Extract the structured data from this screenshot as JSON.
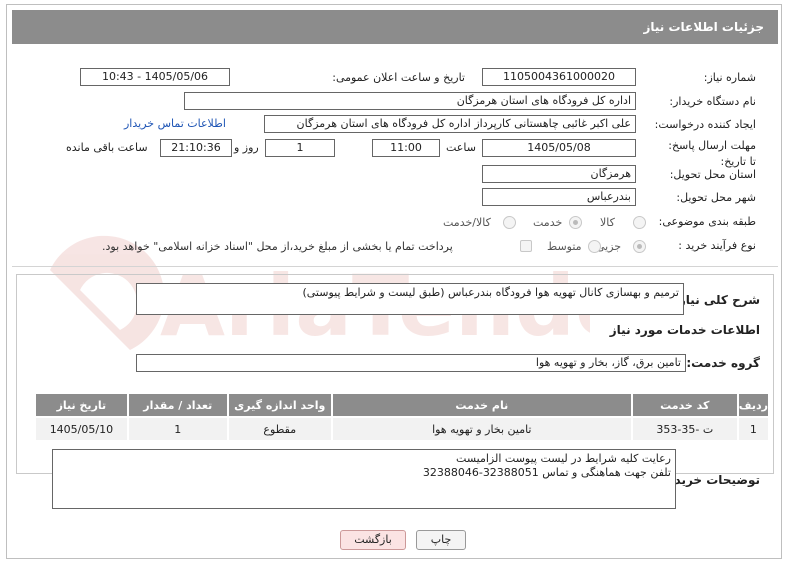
{
  "header": {
    "title": "جزئیات اطلاعات نیاز"
  },
  "fields": {
    "need_number": {
      "label": "شماره نیاز:",
      "value": "1105004361000020"
    },
    "announce_datetime": {
      "label": "تاریخ و ساعت اعلان عمومی:",
      "value": "1405/05/06 - 10:43"
    },
    "buyer_org": {
      "label": "نام دستگاه خریدار:",
      "value": "اداره کل فرودگاه های استان هرمزگان"
    },
    "requester": {
      "label": "ایجاد کننده درخواست:",
      "value": "علی اکبر غائبی چاهستانی کارپرداز اداره کل فرودگاه های استان هرمزگان",
      "contact_link": "اطلاعات تماس خریدار"
    },
    "deadline": {
      "label": "مهلت ارسال پاسخ: تا تاریخ:",
      "date": "1405/05/08",
      "time_label": "ساعت",
      "time": "11:00",
      "days": "1",
      "days_label": "روز و",
      "remaining": "21:10:36",
      "remaining_label": "ساعت باقی مانده"
    },
    "province": {
      "label": "استان محل تحویل:",
      "value": "هرمزگان"
    },
    "city": {
      "label": "شهر محل تحویل:",
      "value": "بندرعباس"
    },
    "category": {
      "label": "طبقه بندی موضوعی:",
      "options": [
        "کالا",
        "خدمت",
        "کالا/خدمت"
      ],
      "selected": "خدمت"
    },
    "purchase_type": {
      "label": "نوع فرآیند خرید :",
      "options": [
        "جزیی",
        "متوسط"
      ],
      "selected": "جزیی",
      "note": "پرداخت تمام یا بخشی از مبلغ خرید،از محل \"اسناد خزانه اسلامی\" خواهد بود."
    }
  },
  "summary": {
    "label": "شرح کلی نیاز:",
    "value": "ترمیم و بهسازی کانال تهویه هوا  فرودگاه بندرعباس (طبق لیست و شرایط پیوستی)"
  },
  "services_title": "اطلاعات خدمات مورد نیاز",
  "service_group": {
    "label": "گروه خدمت:",
    "value": "تامین برق، گاز، بخار و تهویه هوا"
  },
  "table": {
    "headers": [
      "ردیف",
      "کد خدمت",
      "نام خدمت",
      "واحد اندازه گیری",
      "تعداد / مقدار",
      "تاریخ نیاز"
    ],
    "rows": [
      [
        "1",
        "ت -35-353",
        "تامین بخار و تهویه هوا",
        "مقطوع",
        "1",
        "1405/05/10"
      ]
    ]
  },
  "buyer_notes": {
    "label": "توضیحات خریدار:",
    "value": "رعایت کلیه شرایط در لیست پیوست الزامیست\nتلفن جهت هماهنگی و تماس 32388051-32388046"
  },
  "buttons": {
    "print": "چاپ",
    "back": "بازگشت"
  },
  "watermark": "AriaTender.net",
  "colors": {
    "header_bg": "#8c8c8c",
    "link": "#1f55b5",
    "back_button_bg": "#fbe3e3"
  }
}
